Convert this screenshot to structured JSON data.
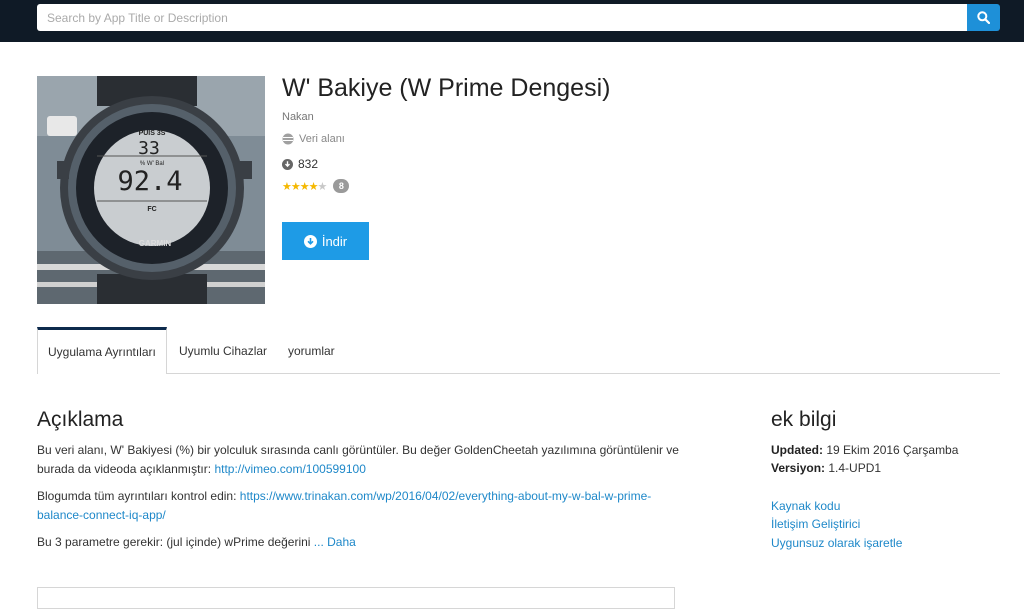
{
  "search": {
    "placeholder": "Search by App Title or Description"
  },
  "app": {
    "title": "W' Bakiye (W Prime Dengesi)",
    "developer": "Nakan",
    "type": "Veri alanı",
    "downloads": "832",
    "rating": 4,
    "rating_count": "8",
    "download_label": "İndir",
    "image": {
      "top_label": "PUIS 3S",
      "top_value": "33",
      "mid_label": "% W' Bal",
      "main_value": "92.4",
      "bottom_label": "FC",
      "brand": "GARMIN"
    }
  },
  "tabs": [
    {
      "label": "Uygulama Ayrıntıları",
      "active": true
    },
    {
      "label": "Uyumlu Cihazlar",
      "active": false
    },
    {
      "label": "yorumlar",
      "active": false
    }
  ],
  "description": {
    "heading": "Açıklama",
    "p1_text": "Bu veri alanı, W' Bakiyesi (%) bir yolculuk sırasında canlı görüntüler. Bu değer GoldenCheetah yazılımına görüntülenir ve burada da videoda açıklanmıştır: ",
    "p1_link": "http://vimeo.com/100599100",
    "p2_text": "Blogumda tüm ayrıntıları kontrol edin: ",
    "p2_link": "https://www.trinakan.com/wp/2016/04/02/everything-about-my-w-bal-w-prime-balance-connect-iq-app/",
    "p3_text": "Bu 3 parametre gerekir: (jul içinde) wPrime değerini ",
    "more": "... Daha"
  },
  "extra_info": {
    "heading": "ek bilgi",
    "updated_label": "Updated:",
    "updated_value": "19 Ekim 2016 Çarşamba",
    "version_label": "Versiyon:",
    "version_value": "1.4-UPD1",
    "links": [
      "Kaynak kodu",
      "İletişim Geliştirici",
      "Uygunsuz olarak işaretle"
    ]
  },
  "colors": {
    "topbar": "#0f1a26",
    "accent": "#1e9be6",
    "link": "#1e88c9",
    "star": "#f5b800"
  }
}
